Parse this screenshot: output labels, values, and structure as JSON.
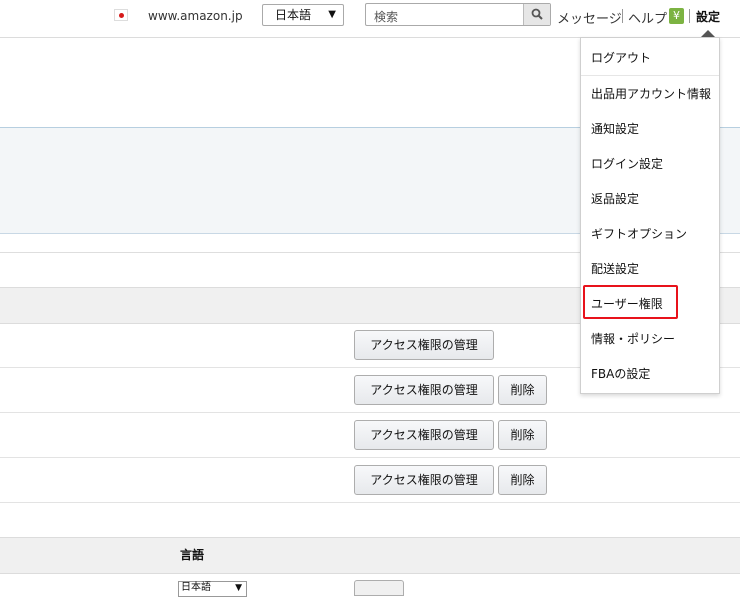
{
  "topbar": {
    "site": "www.amazon.jp",
    "language": "日本語",
    "search_placeholder": "検索",
    "messages": "メッセージ",
    "help": "ヘルプ",
    "yen": "¥",
    "settings": "設定"
  },
  "settings_menu": [
    "ログアウト",
    "出品用アカウント情報",
    "通知設定",
    "ログイン設定",
    "返品設定",
    "ギフトオプション",
    "配送設定",
    "ユーザー権限",
    "情報・ポリシー",
    "FBAの設定"
  ],
  "user_rows": [
    {
      "manage": "アクセス権限の管理",
      "delete": ""
    },
    {
      "manage": "アクセス権限の管理",
      "delete": "削除"
    },
    {
      "manage": "アクセス権限の管理",
      "delete": "削除"
    },
    {
      "manage": "アクセス権限の管理",
      "delete": "削除"
    }
  ],
  "language_section": {
    "column_label": "言語",
    "select_value": "日本語"
  }
}
